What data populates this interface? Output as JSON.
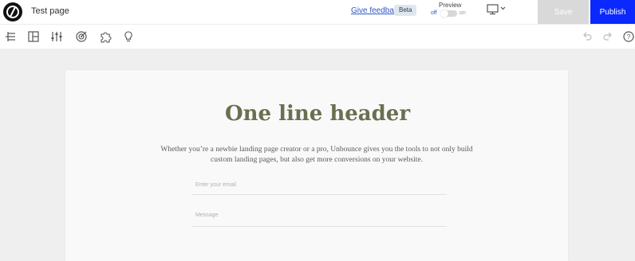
{
  "topbar": {
    "page_title": "Test page",
    "feedback_label": "Give feedback",
    "beta_badge": "Beta",
    "preview": {
      "label": "Preview",
      "off_label": "off",
      "on_label": "on",
      "enabled": false
    },
    "device_icon": "desktop-monitor-icon",
    "save_label": "Save",
    "publish_label": "Publish",
    "colors": {
      "publish": "#0b29ff",
      "save_disabled": "#d9d9d9"
    }
  },
  "toolbar": {
    "tools": [
      "tree-structure-icon",
      "layout-icon",
      "sliders-icon",
      "target-icon",
      "puzzle-icon",
      "lightbulb-icon"
    ],
    "right_tools": [
      "undo-icon",
      "redo-icon",
      "help-icon"
    ]
  },
  "page": {
    "headline": "One line header",
    "body": "Whether you’re a newbie landing page creator or a pro, Unbounce gives you the tools to not only build custom landing pages, but also get more conversions on your website.",
    "email_placeholder": "Enter your email",
    "message_placeholder": "Message",
    "headline_color": "#6b6f50"
  }
}
